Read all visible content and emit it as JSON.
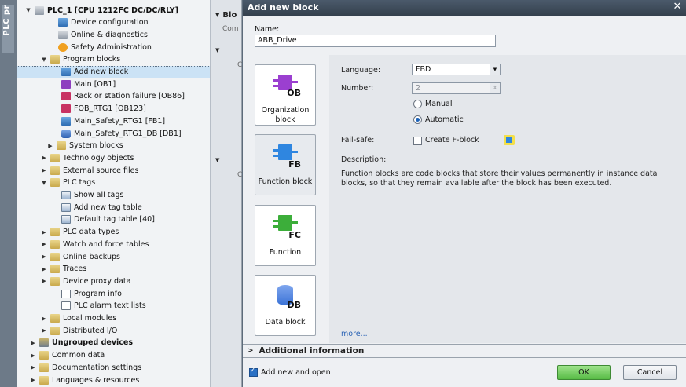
{
  "left_strip": {
    "label": "PLC pr"
  },
  "tree": {
    "items": [
      {
        "label": "PLC_1 [CPU 1212FC DC/DC/RLY]",
        "icon": "plc-icon",
        "bold": true,
        "expanded": true
      },
      {
        "label": "Device configuration",
        "icon": "device-config-icon"
      },
      {
        "label": "Online & diagnostics",
        "icon": "online-diagnostics-icon"
      },
      {
        "label": "Safety Administration",
        "icon": "safety-icon"
      },
      {
        "label": "Program blocks",
        "icon": "folder-icon",
        "expanded": true
      },
      {
        "label": "Add new block",
        "icon": "add-block-icon",
        "selected": true
      },
      {
        "label": "Main [OB1]",
        "icon": "ob-icon"
      },
      {
        "label": "Rack or station failure [OB86]",
        "icon": "ob-red-icon"
      },
      {
        "label": "FOB_RTG1 [OB123]",
        "icon": "ob-red-icon"
      },
      {
        "label": "Main_Safety_RTG1 [FB1]",
        "icon": "fb-icon"
      },
      {
        "label": "Main_Safety_RTG1_DB [DB1]",
        "icon": "db-icon"
      },
      {
        "label": "System blocks",
        "icon": "folder-icon",
        "expanded": false
      },
      {
        "label": "Technology objects",
        "icon": "folder-icon",
        "expanded": false
      },
      {
        "label": "External source files",
        "icon": "folder-icon",
        "expanded": false
      },
      {
        "label": "PLC tags",
        "icon": "folder-icon",
        "expanded": true
      },
      {
        "label": "Show all tags",
        "icon": "tag-table-icon"
      },
      {
        "label": "Add new tag table",
        "icon": "add-tag-table-icon"
      },
      {
        "label": "Default tag table [40]",
        "icon": "tag-table-icon"
      },
      {
        "label": "PLC data types",
        "icon": "folder-icon",
        "expanded": false
      },
      {
        "label": "Watch and force tables",
        "icon": "folder-icon",
        "expanded": false
      },
      {
        "label": "Online backups",
        "icon": "folder-icon",
        "expanded": false
      },
      {
        "label": "Traces",
        "icon": "folder-icon",
        "expanded": false
      },
      {
        "label": "Device proxy data",
        "icon": "folder-icon",
        "expanded": false
      },
      {
        "label": "Program info",
        "icon": "program-info-icon"
      },
      {
        "label": "PLC alarm text lists",
        "icon": "alarm-list-icon"
      },
      {
        "label": "Local modules",
        "icon": "folder-icon",
        "expanded": false
      },
      {
        "label": "Distributed I/O",
        "icon": "folder-icon",
        "expanded": false
      },
      {
        "label": "Ungrouped devices",
        "icon": "devices-folder-icon",
        "bold": true,
        "expanded": false
      },
      {
        "label": "Common data",
        "icon": "folder-icon",
        "expanded": false
      },
      {
        "label": "Documentation settings",
        "icon": "folder-icon",
        "expanded": false
      },
      {
        "label": "Languages & resources",
        "icon": "folder-icon",
        "expanded": false
      }
    ]
  },
  "mid": {
    "header1": "Blo",
    "sub1": "Com",
    "sub2": "C",
    "sub3": "C"
  },
  "dialog": {
    "title": "Add new block",
    "name_label": "Name:",
    "name_value": "ABB_Drive",
    "block_types": [
      {
        "label": "Organization block",
        "suffix": "OB",
        "color": "#9b3fd0"
      },
      {
        "label": "Function block",
        "suffix": "FB",
        "color": "#2f86e0",
        "selected": true
      },
      {
        "label": "Function",
        "suffix": "FC",
        "color": "#3cae3a"
      },
      {
        "label": "Data block",
        "suffix": "DB",
        "color": "#3a72d6"
      }
    ],
    "language_label": "Language:",
    "language_value": "FBD",
    "number_label": "Number:",
    "number_value": "2",
    "manual_label": "Manual",
    "automatic_label": "Automatic",
    "numbering_mode": "Automatic",
    "failsafe_label": "Fail-safe:",
    "create_fblock_label": "Create F-block",
    "description_label": "Description:",
    "description_text": "Function blocks are code blocks that store their values permanently in instance data blocks, so that they remain available after the block has been executed.",
    "more_link": "more...",
    "additional_info_label": "Additional  information",
    "add_new_open_label": "Add new and open",
    "add_new_open_checked": true,
    "ok_label": "OK",
    "cancel_label": "Cancel"
  }
}
